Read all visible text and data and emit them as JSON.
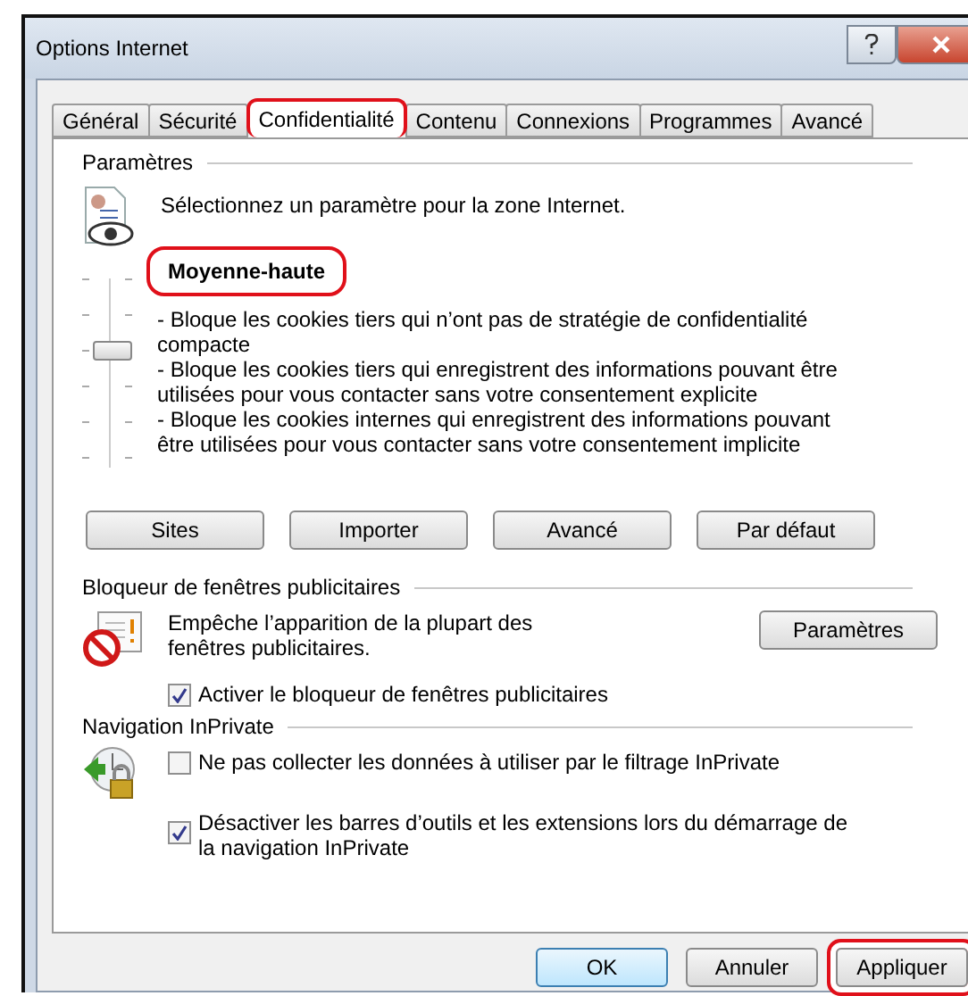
{
  "window": {
    "title": "Options Internet"
  },
  "tabs": [
    {
      "label": "Général",
      "selected": false,
      "highlighted": false
    },
    {
      "label": "Sécurité",
      "selected": false,
      "highlighted": false
    },
    {
      "label": "Confidentialité",
      "selected": true,
      "highlighted": true
    },
    {
      "label": "Contenu",
      "selected": false,
      "highlighted": false
    },
    {
      "label": "Connexions",
      "selected": false,
      "highlighted": false
    },
    {
      "label": "Programmes",
      "selected": false,
      "highlighted": false
    },
    {
      "label": "Avancé",
      "selected": false,
      "highlighted": false
    }
  ],
  "settings": {
    "heading": "Paramètres",
    "intro": "Sélectionnez un paramètre pour la zone Internet.",
    "slider": {
      "level": 0.6
    },
    "level_name": {
      "text": "Moyenne-haute",
      "highlighted": true
    },
    "description": [
      "- Bloque les cookies tiers qui n’ont pas de stratégie de confidentialité compacte",
      "- Bloque les cookies tiers qui enregistrent des informations pouvant être utilisées pour vous contacter sans votre consentement explicite",
      "- Bloque les cookies internes qui enregistrent des informations pouvant être utilisées pour vous contacter sans votre consentement implicite"
    ],
    "buttons": [
      "Sites",
      "Importer",
      "Avancé",
      "Par défaut"
    ]
  },
  "popup_blocker": {
    "heading": "Bloqueur de fenêtres publicitaires",
    "text": "Empêche l’apparition de la plupart des fenêtres publicitaires.",
    "button": "Paramètres",
    "checkbox": {
      "label": "Activer le bloqueur de fenêtres publicitaires",
      "checked": true
    }
  },
  "inprivate": {
    "heading": "Navigation InPrivate",
    "checkboxes": [
      {
        "label": "Ne pas collecter les données à utiliser par le filtrage InPrivate",
        "checked": false
      },
      {
        "label": "Désactiver les barres d’outils et les extensions lors du démarrage de la navigation InPrivate",
        "checked": true
      }
    ]
  },
  "buttons": [
    {
      "label": "OK",
      "default": true,
      "highlighted": false
    },
    {
      "label": "Annuler",
      "default": false,
      "highlighted": false
    },
    {
      "label": "Appliquer",
      "default": false,
      "highlighted": true
    }
  ]
}
